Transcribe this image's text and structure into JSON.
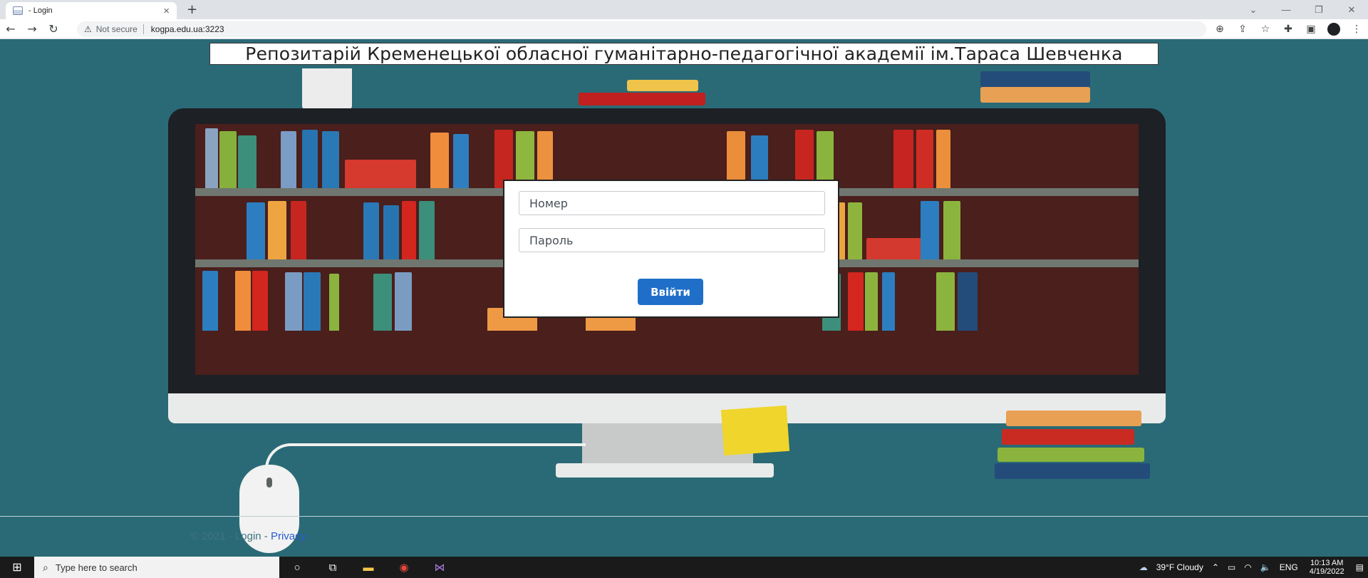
{
  "browser": {
    "tab_title": "- Login",
    "tab_close": "×",
    "new_tab": "+",
    "security_label": "Not secure",
    "url": "kogpa.edu.ua:3223"
  },
  "page": {
    "header_title": "Репозитарій Кременецької обласної гуманітарно-педагогічної академії ім.Тараса Шевченка",
    "login": {
      "number_placeholder": "Номер",
      "password_placeholder": "Пароль",
      "submit_label": "Ввійти"
    },
    "footer": {
      "copyright": "© 2021 - Login - ",
      "privacy_link": "Privacy"
    }
  },
  "taskbar": {
    "search_placeholder": "Type here to search",
    "weather": "39°F  Cloudy",
    "language": "ENG",
    "time": "10:13 AM",
    "date": "4/19/2022"
  }
}
